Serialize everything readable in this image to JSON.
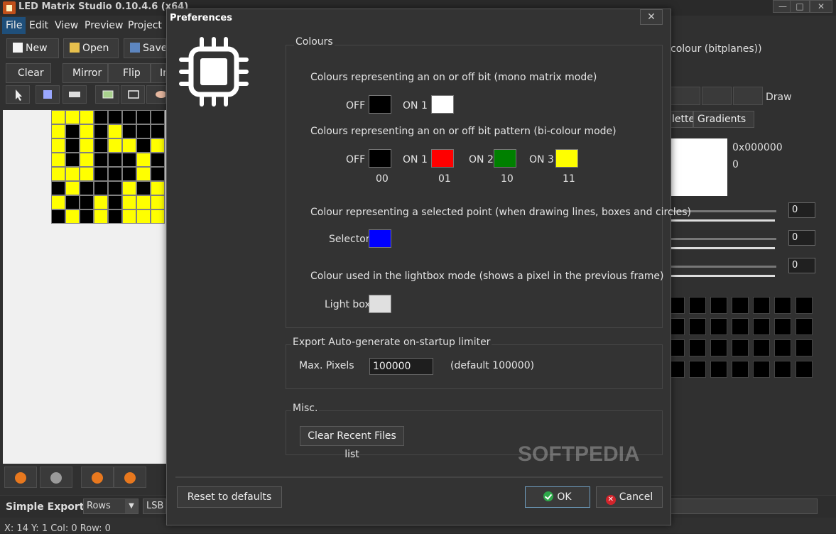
{
  "window": {
    "title": "LED Matrix Studio 0.10.4.6 (x64)"
  },
  "menu": {
    "items": [
      "File",
      "Edit",
      "View",
      "Preview",
      "Project"
    ]
  },
  "toolbar": {
    "new": "New",
    "open": "Open",
    "save": "Save",
    "clear": "Clear",
    "mirror": "Mirror",
    "flip": "Flip",
    "invert_partial": "In"
  },
  "background": {
    "mode_text": "colour (bitplanes))",
    "draw_label": "Draw",
    "tabs": [
      "lette",
      "Gradients"
    ],
    "color_hex": "0x000000",
    "color_value": "0",
    "slider_values": [
      "0",
      "0",
      "0"
    ],
    "simple_export": "Simple Export",
    "rows_select": "Rows",
    "lsb_select": "LSB",
    "status": "X: 14  Y: 1  Col: 0  Row: 0"
  },
  "colors": {
    "yellow": "#ffff00",
    "black": "#000000",
    "off": "#000000",
    "on1_mono": "#ffffff",
    "on1": "#ff0000",
    "on2": "#008000",
    "on3": "#ffff00",
    "selector": "#0000ff",
    "lightbox": "#e0e0e0"
  },
  "matrix": {
    "rows": [
      [
        1,
        1,
        1,
        0,
        0,
        0,
        0,
        0
      ],
      [
        1,
        0,
        1,
        0,
        1,
        0,
        0,
        0
      ],
      [
        1,
        0,
        1,
        0,
        1,
        1,
        0,
        1
      ],
      [
        1,
        0,
        1,
        0,
        0,
        0,
        1,
        0
      ],
      [
        1,
        1,
        1,
        0,
        0,
        0,
        1,
        0
      ],
      [
        0,
        1,
        0,
        0,
        0,
        1,
        0,
        1
      ],
      [
        1,
        0,
        0,
        1,
        0,
        1,
        1,
        1
      ],
      [
        0,
        1,
        0,
        1,
        0,
        1,
        1,
        1
      ]
    ]
  },
  "dialog": {
    "title": "Preferences",
    "close_glyph": "✕",
    "colours": {
      "title": "Colours",
      "mono_desc": "Colours representing an on or off bit (mono matrix mode)",
      "mono_off": "OFF",
      "mono_on1": "ON 1",
      "bi_desc": "Colours representing an on or off bit pattern (bi-colour mode)",
      "bi_off": "OFF",
      "bi_on1": "ON 1",
      "bi_on2": "ON 2",
      "bi_on3": "ON 3",
      "code_00": "00",
      "code_01": "01",
      "code_10": "10",
      "code_11": "11",
      "selector_desc": "Colour representing a selected point (when drawing lines, boxes and circles)",
      "selector_label": "Selector",
      "lightbox_desc": "Colour used in the lightbox mode (shows a pixel in the previous frame)",
      "lightbox_label": "Light box"
    },
    "export": {
      "title": "Export Auto-generate on-startup limiter",
      "max_label": "Max. Pixels",
      "max_value": "100000",
      "default_note": "(default 100000)"
    },
    "misc": {
      "title": "Misc.",
      "clear_recent": "Clear Recent Files list"
    },
    "reset": "Reset to defaults",
    "ok": "OK",
    "cancel": "Cancel"
  },
  "watermark": "SOFTPEDIA"
}
